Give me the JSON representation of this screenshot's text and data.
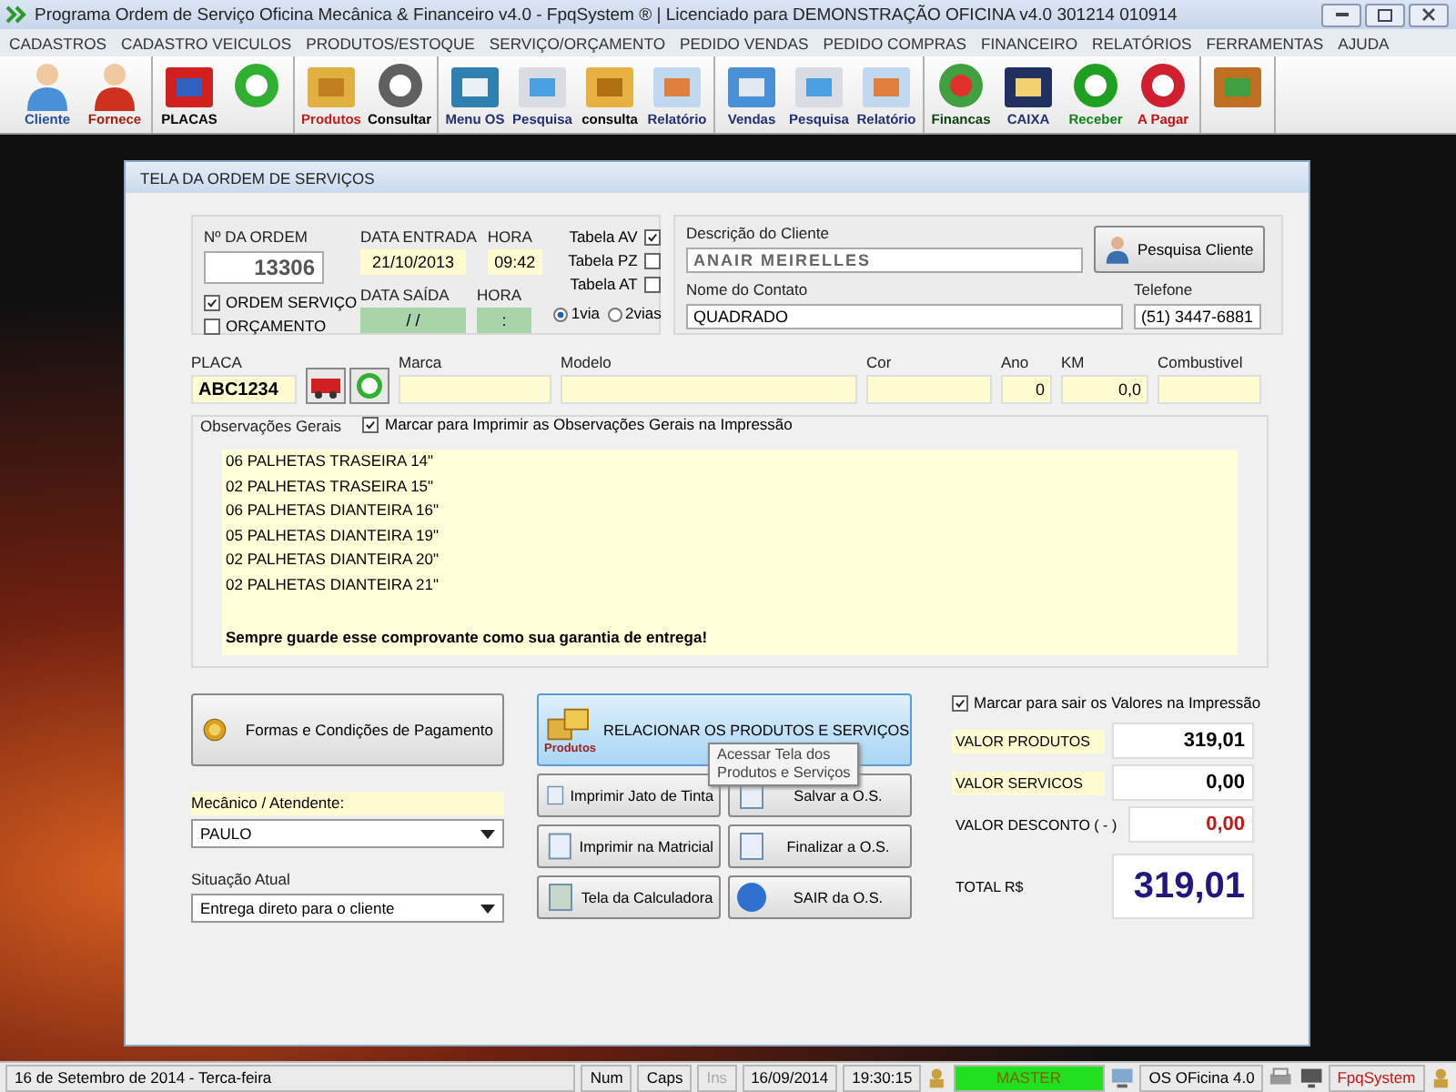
{
  "window": {
    "title": "Programa Ordem de Serviço Oficina Mecânica & Financeiro v4.0 - FpqSystem ® | Licenciado para  DEMONSTRAÇÃO OFICINA v4.0 301214 010914"
  },
  "menu": [
    "CADASTROS",
    "CADASTRO VEICULOS",
    "PRODUTOS/ESTOQUE",
    "SERVIÇO/ORÇAMENTO",
    "PEDIDO VENDAS",
    "PEDIDO COMPRAS",
    "FINANCEIRO",
    "RELATÓRIOS",
    "FERRAMENTAS",
    "AJUDA"
  ],
  "toolbar": [
    {
      "items": [
        {
          "kind": "labeled",
          "label": "Cliente"
        },
        {
          "kind": "labeled",
          "label": "Fornece"
        }
      ]
    },
    {
      "items": [
        {
          "kind": "labeled",
          "label": "PLACAS"
        },
        {
          "kind": "icon"
        }
      ]
    },
    {
      "items": [
        {
          "kind": "labeled",
          "label": "Produtos"
        },
        {
          "kind": "labeled",
          "label": "Consultar"
        }
      ]
    },
    {
      "items": [
        {
          "kind": "labeled",
          "label": "Menu OS"
        },
        {
          "kind": "labeled",
          "label": "Pesquisa"
        },
        {
          "kind": "labeled",
          "label": "consulta"
        },
        {
          "kind": "labeled",
          "label": "Relatório"
        }
      ]
    },
    {
      "items": [
        {
          "kind": "labeled",
          "label": "Vendas"
        },
        {
          "kind": "labeled",
          "label": "Pesquisa"
        },
        {
          "kind": "labeled",
          "label": "Relatório"
        }
      ]
    },
    {
      "items": [
        {
          "kind": "labeled",
          "label": "Financas"
        },
        {
          "kind": "labeled",
          "label": "CAIXA"
        },
        {
          "kind": "labeled",
          "label": "Receber"
        },
        {
          "kind": "labeled",
          "label": "A Pagar"
        }
      ]
    },
    {
      "items": [
        {
          "kind": "icon"
        }
      ]
    }
  ],
  "dialog": {
    "title": "TELA DA ORDEM DE SERVIÇOS",
    "order": {
      "number_label": "Nº DA ORDEM",
      "number": "13306",
      "types": [
        {
          "label": "ORDEM SERVIÇO",
          "checked": true
        },
        {
          "label": "ORÇAMENTO",
          "checked": false
        }
      ]
    },
    "dates": [
      {
        "label": "DATA ENTRADA",
        "value": "21/10/2013",
        "time_label": "HORA",
        "time": "09:42",
        "kind": "entry"
      },
      {
        "label": "DATA SAÍDA",
        "value": "/ /",
        "time_label": "HORA",
        "time": ":",
        "kind": "exit"
      }
    ],
    "tables": [
      {
        "label": "Tabela AV",
        "checked": true
      },
      {
        "label": "Tabela PZ",
        "checked": false
      },
      {
        "label": "Tabela AT",
        "checked": false
      }
    ],
    "copies": [
      {
        "label": "1via",
        "selected": true
      },
      {
        "label": "2vias",
        "selected": false
      }
    ],
    "client": {
      "label": "Descrição do Cliente",
      "value": "ANAIR MEIRELLES",
      "search_button": "Pesquisa Cliente",
      "contact_label": "Nome do Contato",
      "contact": "QUADRADO",
      "phone_label": "Telefone",
      "phone": "(51) 3447-6881"
    },
    "vehicle": [
      {
        "label": "PLACA",
        "value": "ABC1234",
        "kind": "plate"
      },
      {
        "label": "Marca",
        "kind": "text"
      },
      {
        "label": "Modelo",
        "kind": "text"
      },
      {
        "label": "Cor",
        "kind": "text"
      },
      {
        "label": "Ano",
        "value": "0",
        "kind": "number"
      },
      {
        "label": "KM",
        "value": "0,0",
        "kind": "number"
      },
      {
        "label": "Combustivel",
        "kind": "text"
      }
    ],
    "observations": {
      "legend": "Observações Gerais",
      "print_label": "Marcar para Imprimir as Observações Gerais na Impressão",
      "print_checked": true,
      "lines": [
        "06 PALHETAS TRASEIRA 14\"",
        "02 PALHETAS TRASEIRA 15\"",
        "06 PALHETAS DIANTEIRA 16\"",
        "05 PALHETAS DIANTEIRA 19\"",
        "02 PALHETAS DIANTEIRA 20\"",
        "02 PALHETAS DIANTEIRA 21\""
      ],
      "note": "Sempre guarde esse comprovante como sua garantia de entrega!"
    },
    "payment_button": "Formas e Condições de Pagamento",
    "mechanic": {
      "label": "Mecânico / Atendente:",
      "value": "PAULO"
    },
    "situation": {
      "label": "Situação Atual",
      "value": "Entrega direto para o cliente"
    },
    "products_button": {
      "label": "RELACIONAR OS PRODUTOS E SERVIÇOS",
      "icon_caption": "Produtos"
    },
    "tooltip": [
      "Acessar Tela dos",
      "Produtos e Serviços"
    ],
    "actions": [
      {
        "label": "Imprimir Jato de Tinta"
      },
      {
        "label": "Salvar a O.S."
      },
      {
        "label": "Imprimir na Matricial"
      },
      {
        "label": "Finalizar a O.S."
      },
      {
        "label": "Tela da Calculadora"
      },
      {
        "label": "SAIR da O.S."
      }
    ],
    "totals": {
      "print_label": "Marcar para sair os Valores na Impressão",
      "print_checked": true,
      "rows": [
        {
          "label": "VALOR PRODUTOS",
          "value": "319,01",
          "kind": "normal"
        },
        {
          "label": "VALOR SERVICOS",
          "value": "0,00",
          "kind": "normal"
        },
        {
          "label": "VALOR DESCONTO ( - )",
          "value": "0,00",
          "kind": "discount"
        }
      ],
      "total_label": "TOTAL R$",
      "total": "319,01"
    }
  },
  "status_bar": {
    "date": "16 de Setembro de 2014 - Terca-feira",
    "keys": [
      {
        "label": "Num",
        "disabled": false
      },
      {
        "label": "Caps",
        "disabled": false
      },
      {
        "label": "Ins",
        "disabled": true
      }
    ],
    "date_short": "16/09/2014",
    "time": "19:30:15",
    "user": "MASTER",
    "product": "OS OFicina 4.0",
    "brand": "FpqSystem"
  }
}
